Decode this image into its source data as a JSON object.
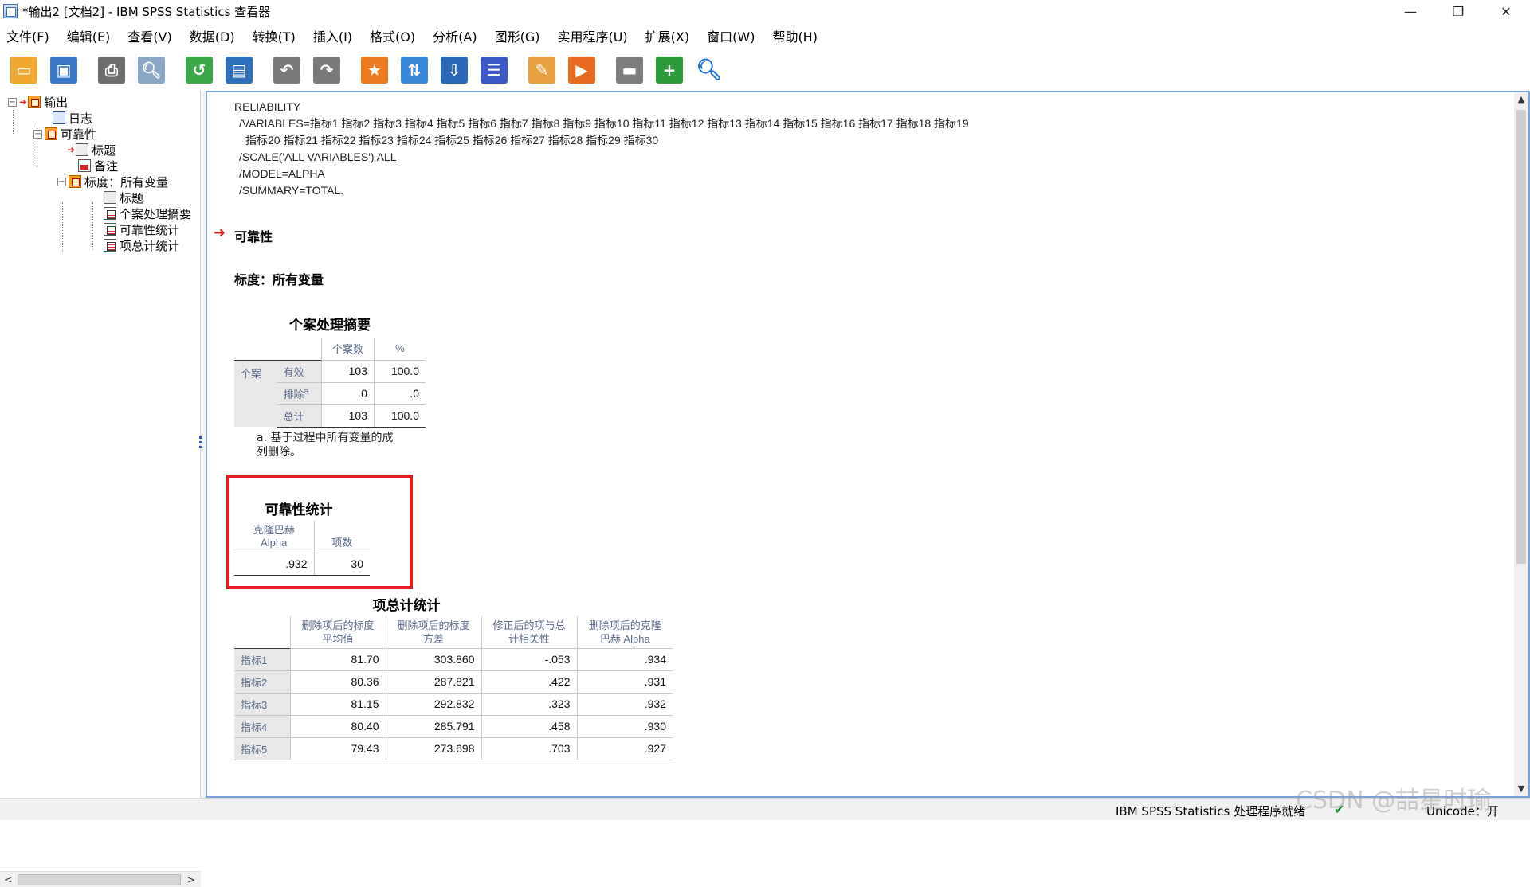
{
  "window": {
    "title": "*输出2 [文档2] - IBM SPSS Statistics 查看器",
    "minimize": "—",
    "restore": "❐",
    "close": "✕"
  },
  "menu": [
    "文件(F)",
    "编辑(E)",
    "查看(V)",
    "数据(D)",
    "转换(T)",
    "插入(I)",
    "格式(O)",
    "分析(A)",
    "图形(G)",
    "实用程序(U)",
    "扩展(X)",
    "窗口(W)",
    "帮助(H)"
  ],
  "toolbar": [
    {
      "name": "open-icon",
      "color": "#f0a830",
      "glyph": "▭"
    },
    {
      "name": "save-icon",
      "color": "#3a78c8",
      "glyph": "▣"
    },
    {
      "name": "print-icon",
      "color": "#6d6d6d",
      "glyph": "⎙"
    },
    {
      "name": "print-preview-icon",
      "color": "#8aa7c8",
      "glyph": "🔍︎"
    },
    {
      "name": "export-icon",
      "color": "#3aa848",
      "glyph": "↺"
    },
    {
      "name": "recall-dialog-icon",
      "color": "#2d6fb8",
      "glyph": "▤"
    },
    {
      "name": "undo-icon",
      "color": "#7a7a7a",
      "glyph": "↶"
    },
    {
      "name": "redo-icon",
      "color": "#7a7a7a",
      "glyph": "↷"
    },
    {
      "name": "goto-data-icon",
      "color": "#f07a20",
      "glyph": "★"
    },
    {
      "name": "goto-case-icon",
      "color": "#3a88d8",
      "glyph": "⇅"
    },
    {
      "name": "goto-variable-icon",
      "color": "#2a6ab8",
      "glyph": "⇩"
    },
    {
      "name": "variables-icon",
      "color": "#3a58c8",
      "glyph": "☰"
    },
    {
      "name": "edit-output-icon",
      "color": "#e8a040",
      "glyph": "✎"
    },
    {
      "name": "run-script-icon",
      "color": "#e86a20",
      "glyph": "▶"
    },
    {
      "name": "hide-icon",
      "color": "#7e7e7e",
      "glyph": "▬"
    },
    {
      "name": "show-icon",
      "color": "#2a9a3a",
      "glyph": "+"
    },
    {
      "name": "search-icon",
      "color": "#ffffff",
      "glyph": "🔍︎"
    }
  ],
  "outline": {
    "root": "输出",
    "log": "日志",
    "reliability": "可靠性",
    "title": "标题",
    "notes": "备注",
    "scale": "标度：所有变量",
    "scale_title": "标题",
    "case_summary": "个案处理摘要",
    "reliability_stats": "可靠性统计",
    "item_total": "项总计统计"
  },
  "syntax": [
    "RELIABILITY",
    "  /VARIABLES=指标1 指标2 指标3 指标4 指标5 指标6 指标7 指标8 指标9 指标10 指标11 指标12 指标13 指标14 指标15 指标16 指标17 指标18 指标19",
    "    指标20 指标21 指标22 指标23 指标24 指标25 指标26 指标27 指标28 指标29 指标30",
    "  /SCALE('ALL VARIABLES') ALL",
    "  /MODEL=ALPHA",
    "  /SUMMARY=TOTAL."
  ],
  "headings": {
    "reliability": "可靠性",
    "scale": "标度：所有变量"
  },
  "case_summary": {
    "title": "个案处理摘要",
    "col_n": "个案数",
    "col_pct": "%",
    "group": "个案",
    "rows": [
      {
        "label": "有效",
        "n": "103",
        "pct": "100.0"
      },
      {
        "label": "排除",
        "sup": "a",
        "n": "0",
        "pct": ".0"
      },
      {
        "label": "总计",
        "n": "103",
        "pct": "100.0"
      }
    ],
    "footnote": "a. 基于过程中所有变量的成列删除。"
  },
  "reliability_stats": {
    "title": "可靠性统计",
    "col_alpha_1": "克隆巴赫",
    "col_alpha_2": "Alpha",
    "col_items": "项数",
    "alpha": ".932",
    "items": "30"
  },
  "item_total": {
    "title": "项总计统计",
    "cols": [
      "删除项后的标度平均值",
      "删除项后的标度方差",
      "修正后的项与总计相关性",
      "删除项后的克隆巴赫 Alpha"
    ],
    "rows": [
      {
        "label": "指标1",
        "mean": "81.70",
        "var": "303.860",
        "corr": "-.053",
        "alpha": ".934"
      },
      {
        "label": "指标2",
        "mean": "80.36",
        "var": "287.821",
        "corr": ".422",
        "alpha": ".931"
      },
      {
        "label": "指标3",
        "mean": "81.15",
        "var": "292.832",
        "corr": ".323",
        "alpha": ".932"
      },
      {
        "label": "指标4",
        "mean": "80.40",
        "var": "285.791",
        "corr": ".458",
        "alpha": ".930"
      },
      {
        "label": "指标5",
        "mean": "79.43",
        "var": "273.698",
        "corr": ".703",
        "alpha": ".927"
      }
    ]
  },
  "status": {
    "main": "IBM SPSS Statistics 处理程序就绪",
    "unicode": "Unicode：开"
  },
  "watermark": "CSDN @喆星时瑜"
}
